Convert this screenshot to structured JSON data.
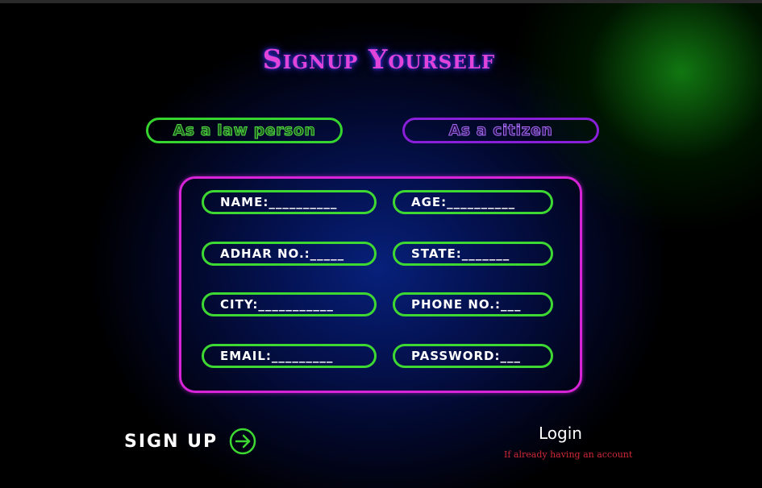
{
  "title": "Signup Yourself",
  "choices": {
    "law_person": "As a law person",
    "citizen": "As a citizen"
  },
  "fields": {
    "name": "NAME:__________",
    "age": "AGE:__________",
    "adhar": "ADHAR NO.:_____",
    "state": "STATE:_______",
    "city": "CITY:___________",
    "phone": "PHONE NO.:___",
    "email": "EMAIL:_________",
    "password": "PASSWORD:___"
  },
  "signup": {
    "label": "SIGN UP",
    "icon": "arrow-right-circle-icon"
  },
  "login": {
    "label": "Login",
    "hint": "If already having an account"
  },
  "colors": {
    "title": "#e044d8",
    "title_glow": "#3b2ee6",
    "green_accent": "#3ed832",
    "purple_accent": "#8a1fd9",
    "magenta_border": "#d724d8",
    "hint_red": "#d02838"
  }
}
